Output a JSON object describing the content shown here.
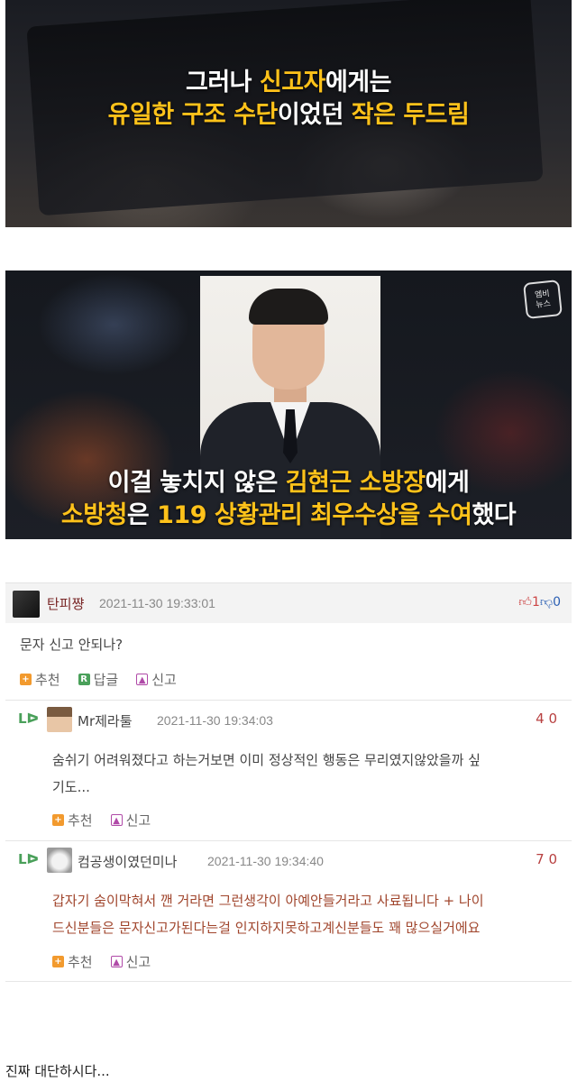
{
  "frame1": {
    "caption_line1_pre": "그러나 ",
    "caption_line1_hl": "신고자",
    "caption_line1_post": "에게는",
    "caption_line2_hl1": "유일한 구조 수단",
    "caption_line2_mid": "이었던 ",
    "caption_line2_hl2": "작은 두드림"
  },
  "frame2": {
    "caption_line1_pre": "이걸 놓치지 않은 ",
    "caption_line1_hl": "김현근 소방장",
    "caption_line1_post": "에게",
    "caption_line2_pre": "소방청",
    "caption_line2_mid1": "은 ",
    "caption_line2_hl": "119 상황관리 최우수상을 수여",
    "caption_line2_post": "했다",
    "logo_text": "엠비\n뉴스"
  },
  "comments": {
    "top": {
      "author": "탄피쨩",
      "date": "2021-11-30 19:33:01",
      "up_icon": "thumbs-up-icon",
      "up_count": "1",
      "down_icon": "thumbs-down-icon",
      "down_count": "0",
      "text": "문자 신고 안되나?",
      "actions": {
        "recommend": "추천",
        "reply": "답글",
        "report": "신고"
      }
    },
    "reply1": {
      "author": "Mr제라툴",
      "date": "2021-11-30 19:34:03",
      "score": "4 0",
      "text_line1": "숨쉬기 어려워졌다고 하는거보면 이미 정상적인 행동은 무리였지않았을까 싶",
      "text_line2": "기도...",
      "actions": {
        "recommend": "추천",
        "report": "신고"
      }
    },
    "reply2": {
      "author": "컴공생이였던미나",
      "date": "2021-11-30 19:34:40",
      "score": "7 0",
      "text_line1": "갑자기 숨이막혀서 깬 거라면 그런생각이 아예안들거라고 사료됩니다 + 나이",
      "text_line2": "드신분들은 문자신고가된다는걸 인지하지못하고계신분들도 꽤 많으실거에요",
      "actions": {
        "recommend": "추천",
        "report": "신고"
      }
    },
    "reply_arrow": "Lᐅ"
  },
  "footer": {
    "text": "진짜 대단하시다..."
  },
  "colors": {
    "caption_highlight": "#ffc21a",
    "author": "#7a2828",
    "reply2_text": "#a0452c"
  }
}
